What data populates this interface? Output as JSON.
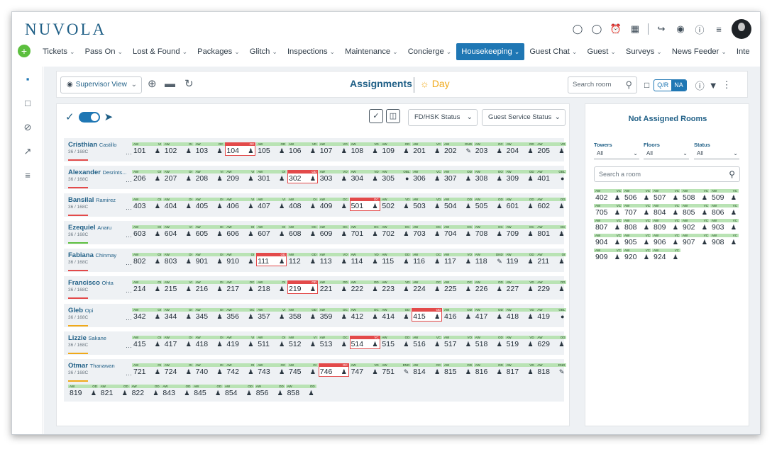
{
  "app": {
    "logo": "NUVOLA"
  },
  "header_icons": [
    "chat-bubble-icon",
    "message-icon",
    "alarm-clock-icon",
    "calendar-icon",
    "runner-icon",
    "globe-icon",
    "help-icon",
    "settings-sliders-icon"
  ],
  "nav": {
    "items": [
      "Tickets",
      "Pass On",
      "Lost & Found",
      "Packages",
      "Glitch",
      "Inspections",
      "Maintenance",
      "Concierge",
      "Housekeeping",
      "Guest Chat",
      "Guest",
      "Surveys",
      "News Feeder",
      "Inte"
    ],
    "active": "Housekeeping"
  },
  "toolbar": {
    "supervisor_view": "Supervisor View",
    "title": "Assignments",
    "day_label": "Day",
    "search_placeholder": "Search room",
    "qr_label": "Q/R",
    "na_label": "NA"
  },
  "filters": {
    "fd_hsk": "FD/HSK Status",
    "guest_service": "Guest Service Status"
  },
  "attendants": [
    {
      "first": "Cristhian",
      "last": "Castillo",
      "count": "36 / 168C",
      "bar": "#e34a4a"
    },
    {
      "first": "Alexander",
      "last": "Desrints...",
      "count": "36 / 168C",
      "bar": "#e34a4a"
    },
    {
      "first": "Bansilal",
      "last": "Ramirez",
      "count": "36 / 168C",
      "bar": "#e34a4a"
    },
    {
      "first": "Ezequiel",
      "last": "Anaru",
      "count": "36 / 168C",
      "bar": "#5cbf3e"
    },
    {
      "first": "Fabiana",
      "last": "Chinmay",
      "count": "36 / 168C",
      "bar": "#e34a4a"
    },
    {
      "first": "Francisco",
      "last": "Ohta",
      "count": "36 / 168C",
      "bar": "#e34a4a"
    },
    {
      "first": "Gleb",
      "last": "Opi",
      "count": "36 / 168C",
      "bar": "#f0a91a"
    },
    {
      "first": "Lizzie",
      "last": "Sakane",
      "count": "36 / 168C",
      "bar": "#f0a91a"
    },
    {
      "first": "Otmar",
      "last": "Thanawan",
      "count": "36 / 168C",
      "bar": "#f0a91a"
    }
  ],
  "rooms": [
    [
      [
        "101",
        "AW",
        "VI",
        "p"
      ],
      [
        "102",
        "AW",
        "OI",
        "p"
      ],
      [
        "103",
        "AW",
        "OC",
        "p"
      ],
      [
        "104",
        "",
        "OC",
        "p",
        1
      ],
      [
        "105",
        "AW",
        "OD",
        "p"
      ],
      [
        "106",
        "AW",
        "VD",
        "p"
      ],
      [
        "107",
        "AW",
        "VO",
        "p"
      ],
      [
        "108",
        "AW",
        "VD",
        "p"
      ],
      [
        "109",
        "AW",
        "OD",
        "p"
      ],
      [
        "201",
        "AW",
        "VC",
        "p"
      ],
      [
        "202",
        "AW",
        "DND",
        "t"
      ],
      [
        "203",
        "AW",
        "OC",
        "p"
      ],
      [
        "204",
        "AW",
        "OD",
        "p"
      ],
      [
        "205",
        "AW",
        "VD",
        "p"
      ]
    ],
    [
      [
        "206",
        "AW",
        "OI",
        "p"
      ],
      [
        "207",
        "AW",
        "OI",
        "p"
      ],
      [
        "208",
        "AW",
        "VI",
        "p"
      ],
      [
        "209",
        "AW",
        "VI",
        "p"
      ],
      [
        "301",
        "AW",
        "OI",
        "p"
      ],
      [
        "302",
        "",
        "OD",
        "p",
        1
      ],
      [
        "303",
        "AW",
        "VO",
        "p"
      ],
      [
        "304",
        "AW",
        "VD",
        "p"
      ],
      [
        "305",
        "AW",
        "OBL",
        "b"
      ],
      [
        "306",
        "AW",
        "VC",
        "p"
      ],
      [
        "307",
        "AW",
        "OD",
        "p"
      ],
      [
        "308",
        "AW",
        "OO",
        "p"
      ],
      [
        "309",
        "AW",
        "OD",
        "p"
      ],
      [
        "401",
        "AW",
        "OBL",
        "b"
      ]
    ],
    [
      [
        "403",
        "AW",
        "OI",
        "p"
      ],
      [
        "404",
        "AW",
        "OI",
        "p"
      ],
      [
        "405",
        "AW",
        "OI",
        "p"
      ],
      [
        "406",
        "AW",
        "VI",
        "p"
      ],
      [
        "407",
        "AW",
        "VI",
        "p"
      ],
      [
        "408",
        "AW",
        "OI",
        "p"
      ],
      [
        "409",
        "AW",
        "OC",
        "p"
      ],
      [
        "501",
        "",
        "OC",
        "p",
        1
      ],
      [
        "502",
        "AW",
        "VD",
        "p"
      ],
      [
        "503",
        "AW",
        "VD",
        "p"
      ],
      [
        "504",
        "AW",
        "OD",
        "p"
      ],
      [
        "505",
        "AW",
        "OD",
        "p"
      ],
      [
        "601",
        "AW",
        "OD",
        "p"
      ],
      [
        "602",
        "AW",
        "OD",
        "p"
      ]
    ],
    [
      [
        "603",
        "AW",
        "OI",
        "p"
      ],
      [
        "604",
        "AW",
        "VI",
        "p"
      ],
      [
        "605",
        "AW",
        "OI",
        "p"
      ],
      [
        "606",
        "AW",
        "OI",
        "p"
      ],
      [
        "607",
        "AW",
        "OI",
        "p"
      ],
      [
        "608",
        "AW",
        "OC",
        "p"
      ],
      [
        "609",
        "AW",
        "OC",
        "p"
      ],
      [
        "701",
        "AW",
        "OC",
        "p"
      ],
      [
        "702",
        "AW",
        "OC",
        "p"
      ],
      [
        "703",
        "AW",
        "OC",
        "p"
      ],
      [
        "704",
        "AW",
        "OC",
        "p"
      ],
      [
        "708",
        "AW",
        "OC",
        "p"
      ],
      [
        "709",
        "AW",
        "OC",
        "p"
      ],
      [
        "801",
        "AW",
        "OC",
        "p"
      ]
    ],
    [
      [
        "802",
        "AW",
        "OI",
        "p"
      ],
      [
        "803",
        "AW",
        "OI",
        "p"
      ],
      [
        "901",
        "AW",
        "OI",
        "p"
      ],
      [
        "910",
        "AW",
        "OI",
        "p"
      ],
      [
        "111",
        "",
        "OD",
        "p",
        1
      ],
      [
        "112",
        "AW",
        "OD",
        "p"
      ],
      [
        "113",
        "AW",
        "VO",
        "p"
      ],
      [
        "114",
        "AW",
        "VD",
        "p"
      ],
      [
        "115",
        "AW",
        "OD",
        "p"
      ],
      [
        "116",
        "AW",
        "OC",
        "p"
      ],
      [
        "117",
        "AW",
        "VO",
        "p"
      ],
      [
        "118",
        "AW",
        "DND",
        "t"
      ],
      [
        "119",
        "AW",
        "OD",
        "p"
      ],
      [
        "211",
        "AW",
        "OI",
        "p"
      ]
    ],
    [
      [
        "214",
        "AW",
        "OI",
        "p"
      ],
      [
        "215",
        "AW",
        "VI",
        "p"
      ],
      [
        "216",
        "AW",
        "OI",
        "p"
      ],
      [
        "217",
        "AW",
        "OC",
        "p"
      ],
      [
        "218",
        "AW",
        "OI",
        "p"
      ],
      [
        "219",
        "",
        "OD",
        "p",
        1
      ],
      [
        "221",
        "AW",
        "OD",
        "p"
      ],
      [
        "222",
        "AW",
        "OD",
        "p"
      ],
      [
        "223",
        "AW",
        "VD",
        "p"
      ],
      [
        "224",
        "AW",
        "OC",
        "p"
      ],
      [
        "225",
        "AW",
        "OC",
        "p"
      ],
      [
        "226",
        "AW",
        "OD",
        "p"
      ],
      [
        "227",
        "AW",
        "VD",
        "p"
      ],
      [
        "229",
        "AW",
        "OD",
        "p"
      ]
    ],
    [
      [
        "342",
        "AW",
        "OI",
        "p"
      ],
      [
        "344",
        "AW",
        "OI",
        "p"
      ],
      [
        "345",
        "AW",
        "OI",
        "p"
      ],
      [
        "356",
        "AW",
        "OC",
        "p"
      ],
      [
        "357",
        "AW",
        "VI",
        "p"
      ],
      [
        "358",
        "AW",
        "OD",
        "p"
      ],
      [
        "359",
        "AW",
        "OC",
        "p"
      ],
      [
        "412",
        "AW",
        "OC",
        "p"
      ],
      [
        "414",
        "AW",
        "OD",
        "p"
      ],
      [
        "415",
        "",
        "OD",
        "p",
        1
      ],
      [
        "416",
        "AW",
        "OD",
        "p"
      ],
      [
        "417",
        "AW",
        "OD",
        "p"
      ],
      [
        "418",
        "AW",
        "VD",
        "p"
      ],
      [
        "419",
        "AW",
        "OBL",
        "b"
      ]
    ],
    [
      [
        "415",
        "AW",
        "OI",
        "p"
      ],
      [
        "417",
        "AW",
        "OI",
        "p"
      ],
      [
        "418",
        "AW",
        "OI",
        "p"
      ],
      [
        "419",
        "AW",
        "VI",
        "p"
      ],
      [
        "511",
        "AW",
        "OI",
        "p"
      ],
      [
        "512",
        "AW",
        "VI",
        "p"
      ],
      [
        "513",
        "AW",
        "OC",
        "p"
      ],
      [
        "514",
        "",
        "VC",
        "p",
        1
      ],
      [
        "515",
        "AW",
        "OD",
        "p"
      ],
      [
        "516",
        "AW",
        "VC",
        "p"
      ],
      [
        "517",
        "AW",
        "VO",
        "p"
      ],
      [
        "518",
        "AW",
        "OD",
        "p"
      ],
      [
        "519",
        "AW",
        "VD",
        "p"
      ],
      [
        "629",
        "AW",
        "OD",
        "p"
      ]
    ],
    [
      [
        "721",
        "AW",
        "OI",
        "p"
      ],
      [
        "724",
        "AW",
        "OI",
        "p"
      ],
      [
        "740",
        "AW",
        "OI",
        "p"
      ],
      [
        "742",
        "AW",
        "OI",
        "p"
      ],
      [
        "743",
        "AW",
        "OC",
        "p"
      ],
      [
        "745",
        "AW",
        "OI",
        "p"
      ],
      [
        "746",
        "",
        "OC",
        "p",
        1
      ],
      [
        "747",
        "AW",
        "VD",
        "p"
      ],
      [
        "751",
        "AW",
        "DND",
        "t"
      ],
      [
        "814",
        "AW",
        "OC",
        "p"
      ],
      [
        "815",
        "AW",
        "OD",
        "p"
      ],
      [
        "816",
        "AW",
        "OD",
        "p"
      ],
      [
        "817",
        "AW",
        "VD",
        "p"
      ],
      [
        "818",
        "AW",
        "DND",
        "t"
      ],
      [
        "819",
        "AW",
        "OD",
        "p"
      ],
      [
        "821",
        "AW",
        "OD",
        "p"
      ],
      [
        "822",
        "AW",
        "OD",
        "p"
      ],
      [
        "843",
        "AW",
        "OD",
        "p"
      ],
      [
        "845",
        "AW",
        "OD",
        "p"
      ],
      [
        "854",
        "AW",
        "OD",
        "p"
      ],
      [
        "856",
        "AW",
        "OD",
        "p"
      ],
      [
        "858",
        "AW",
        "OD",
        "p"
      ]
    ]
  ],
  "not_assigned": {
    "title": "Not Assigned Rooms",
    "filters": [
      {
        "label": "Towers",
        "value": "All"
      },
      {
        "label": "Floors",
        "value": "All"
      },
      {
        "label": "Status",
        "value": "All"
      }
    ],
    "search_placeholder": "Search a room",
    "rooms": [
      [
        "402",
        "AW",
        "VC"
      ],
      [
        "506",
        "AW",
        "VC"
      ],
      [
        "507",
        "AW",
        "VC"
      ],
      [
        "508",
        "AW",
        "VC"
      ],
      [
        "509",
        "AW",
        "VC"
      ],
      [
        "705",
        "AW",
        "VC"
      ],
      [
        "707",
        "AW",
        "VC"
      ],
      [
        "804",
        "AW",
        "VC"
      ],
      [
        "805",
        "AW",
        "VC"
      ],
      [
        "806",
        "AW",
        "VC"
      ],
      [
        "807",
        "AW",
        "VC"
      ],
      [
        "808",
        "AW",
        "VC"
      ],
      [
        "809",
        "AW",
        "VC"
      ],
      [
        "902",
        "AW",
        "VC"
      ],
      [
        "903",
        "AW",
        "VC"
      ],
      [
        "904",
        "AW",
        "VC"
      ],
      [
        "905",
        "AW",
        "VC"
      ],
      [
        "906",
        "AW",
        "VC"
      ],
      [
        "907",
        "AW",
        "VC"
      ],
      [
        "908",
        "AW",
        "VC"
      ],
      [
        "909",
        "AW",
        "VC"
      ],
      [
        "920",
        "AW",
        "VC"
      ],
      [
        "924",
        "AW",
        "VC"
      ]
    ]
  },
  "colors": {
    "accent": "#1f77b4",
    "status_green": "#b9e3b4",
    "status_red": "#e34a4a",
    "day": "#f0a91a"
  }
}
